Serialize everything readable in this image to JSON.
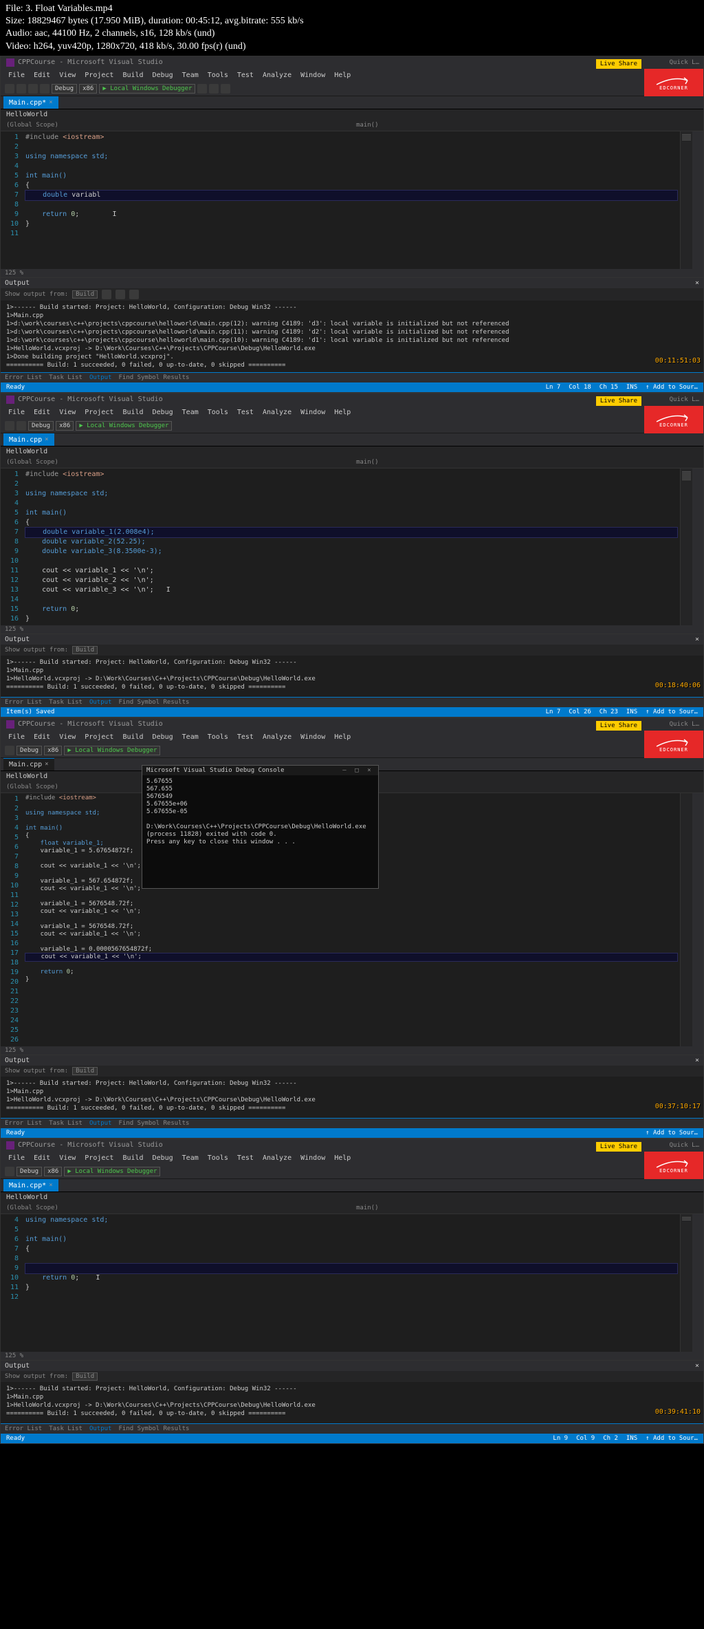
{
  "header": {
    "file": "File: 3. Float Variables.mp4",
    "size": "Size: 18829467 bytes (17.950 MiB), duration: 00:45:12, avg.bitrate: 555 kb/s",
    "audio": "Audio: aac, 44100 Hz, 2 channels, s16, 128 kb/s (und)",
    "video": "Video: h264, yuv420p, 1280x720, 418 kb/s, 30.00 fps(r) (und)"
  },
  "vs": {
    "title": "CPPCourse - Microsoft Visual Studio",
    "menu": [
      "File",
      "Edit",
      "View",
      "Project",
      "Build",
      "Debug",
      "Team",
      "Tools",
      "Test",
      "Analyze",
      "Window",
      "Help"
    ],
    "toolbar": {
      "config": "Debug",
      "platform": "x86",
      "start": "▶ Local Windows Debugger"
    },
    "live_share": "Live Share",
    "quick": "Quick L…",
    "logo": "EDCORNER",
    "file_tab": "Main.cpp",
    "file_tab_active": "Main.cpp*",
    "ws_tab": "HelloWorld",
    "scope_global": "(Global Scope)",
    "scope_main": "main()",
    "zoom": "125 %",
    "output_title": "Output",
    "output_from": "Show output from:",
    "output_build": "Build",
    "error_tabs": [
      "Error List",
      "Task List",
      "Output",
      "Find Symbol Results"
    ]
  },
  "panel1": {
    "lines": [
      "1",
      "2",
      "3",
      "4",
      "5",
      "6",
      "7",
      "8",
      "9",
      "10",
      "11"
    ],
    "code": {
      "l1_pp": "#include ",
      "l1_inc": "<iostream>",
      "l3": "using namespace std;",
      "l5": "int main()",
      "l6": "{",
      "l7_kw": "    double",
      "l7_id": " variabl",
      "l9_kw": "    return ",
      "l9_num": "0",
      "l9_end": ";",
      "l10": "}"
    },
    "output": "1>------ Build started: Project: HelloWorld, Configuration: Debug Win32 ------\n1>Main.cpp\n1>d:\\work\\courses\\c++\\projects\\cppcourse\\helloworld\\main.cpp(12): warning C4189: 'd3': local variable is initialized but not referenced\n1>d:\\work\\courses\\c++\\projects\\cppcourse\\helloworld\\main.cpp(11): warning C4189: 'd2': local variable is initialized but not referenced\n1>d:\\work\\courses\\c++\\projects\\cppcourse\\helloworld\\main.cpp(10): warning C4189: 'd1': local variable is initialized but not referenced\n1>HelloWorld.vcxproj -> D:\\Work\\Courses\\C++\\Projects\\CPPCourse\\Debug\\HelloWorld.exe\n1>Done building project \"HelloWorld.vcxproj\".\n========== Build: 1 succeeded, 0 failed, 0 up-to-date, 0 skipped ==========",
    "status": {
      "ready": "Ready",
      "ln": "Ln 7",
      "col": "Col 18",
      "ch": "Ch 15",
      "ins": "INS",
      "add": "↑ Add to Sour…"
    },
    "timecode": "00:11:51:03"
  },
  "panel2": {
    "lines": [
      "1",
      "2",
      "3",
      "4",
      "5",
      "6",
      "7",
      "8",
      "9",
      "10",
      "11",
      "12",
      "13",
      "14",
      "15",
      "16"
    ],
    "code": {
      "l1_pp": "#include ",
      "l1_inc": "<iostream>",
      "l3": "using namespace std;",
      "l5": "int main()",
      "l6": "{",
      "l7": "    double variable_1(2.008e4);",
      "l8": "    double variable_2(52.25);",
      "l9": "    double variable_3(8.3500e-3);",
      "l11": "    cout << variable_1 << '\\n';",
      "l12": "    cout << variable_2 << '\\n';",
      "l13": "    cout << variable_3 << '\\n';",
      "l15_kw": "    return ",
      "l15_num": "0",
      "l15_end": ";",
      "l16": "}"
    },
    "output": "1>------ Build started: Project: HelloWorld, Configuration: Debug Win32 ------\n1>Main.cpp\n1>HelloWorld.vcxproj -> D:\\Work\\Courses\\C++\\Projects\\CPPCourse\\Debug\\HelloWorld.exe\n========== Build: 1 succeeded, 0 failed, 0 up-to-date, 0 skipped ==========",
    "status": {
      "ready": "Item(s) Saved",
      "ln": "Ln 7",
      "col": "Col 26",
      "ch": "Ch 23",
      "ins": "INS",
      "add": "↑ Add to Sour…"
    },
    "timecode": "00:18:40:06"
  },
  "panel3": {
    "lines": [
      "1",
      "2",
      "3",
      "4",
      "5",
      "6",
      "7",
      "8",
      "9",
      "10",
      "11",
      "12",
      "13",
      "14",
      "15",
      "16",
      "17",
      "18",
      "19",
      "20",
      "21",
      "22",
      "23",
      "24",
      "25",
      "26"
    ],
    "code": {
      "l1_pp": "#include ",
      "l1_inc": "<iostream>",
      "l3": "using namespace std;",
      "l5": "int main()",
      "l6": "{",
      "l7": "    float variable_1;",
      "l8": "    variable_1 = 5.67654872f;",
      "l10": "    cout << variable_1 << '\\n';",
      "l12": "    variable_1 = 567.654872f;",
      "l13": "    cout << variable_1 << '\\n';",
      "l15": "    variable_1 = 5676548.72f;",
      "l16": "    cout << variable_1 << '\\n';",
      "l18": "    variable_1 = 5676548.72f;",
      "l19": "    cout << variable_1 << '\\n';",
      "l21": "    variable_1 = 0.0000567654872f;",
      "l22": "    cout << variable_1 << '\\n';",
      "l24_kw": "    return ",
      "l24_num": "0",
      "l24_end": ";",
      "l25": "}"
    },
    "console": {
      "title": "Microsoft Visual Studio Debug Console",
      "body": "5.67655\n567.655\n5676549\n5.67655e+06\n5.67655e-05\n\nD:\\Work\\Courses\\C++\\Projects\\CPPCourse\\Debug\\HelloWorld.exe (process 11828) exited with code 0.\nPress any key to close this window . . ."
    },
    "output": "1>------ Build started: Project: HelloWorld, Configuration: Debug Win32 ------\n1>Main.cpp\n1>HelloWorld.vcxproj -> D:\\Work\\Courses\\C++\\Projects\\CPPCourse\\Debug\\HelloWorld.exe\n========== Build: 1 succeeded, 0 failed, 0 up-to-date, 0 skipped ==========",
    "status": {
      "ready": "Ready",
      "add": "↑ Add to Sour…"
    },
    "timecode": "00:37:10:17"
  },
  "panel4": {
    "lines": [
      "4",
      "5",
      "6",
      "7",
      "8",
      "9",
      "10",
      "11",
      "12"
    ],
    "code": {
      "l4": "using namespace std;",
      "l6": "int main()",
      "l7": "{",
      "l10_kw": "    return ",
      "l10_num": "0",
      "l10_end": ";",
      "l11": "}"
    },
    "output": "1>------ Build started: Project: HelloWorld, Configuration: Debug Win32 ------\n1>Main.cpp\n1>HelloWorld.vcxproj -> D:\\Work\\Courses\\C++\\Projects\\CPPCourse\\Debug\\HelloWorld.exe\n========== Build: 1 succeeded, 0 failed, 0 up-to-date, 0 skipped ==========",
    "status": {
      "ready": "Ready",
      "ln": "Ln 9",
      "col": "Col 9",
      "ch": "Ch 2",
      "ins": "INS",
      "add": "↑ Add to Sour…"
    },
    "timecode": "00:39:41:10"
  }
}
